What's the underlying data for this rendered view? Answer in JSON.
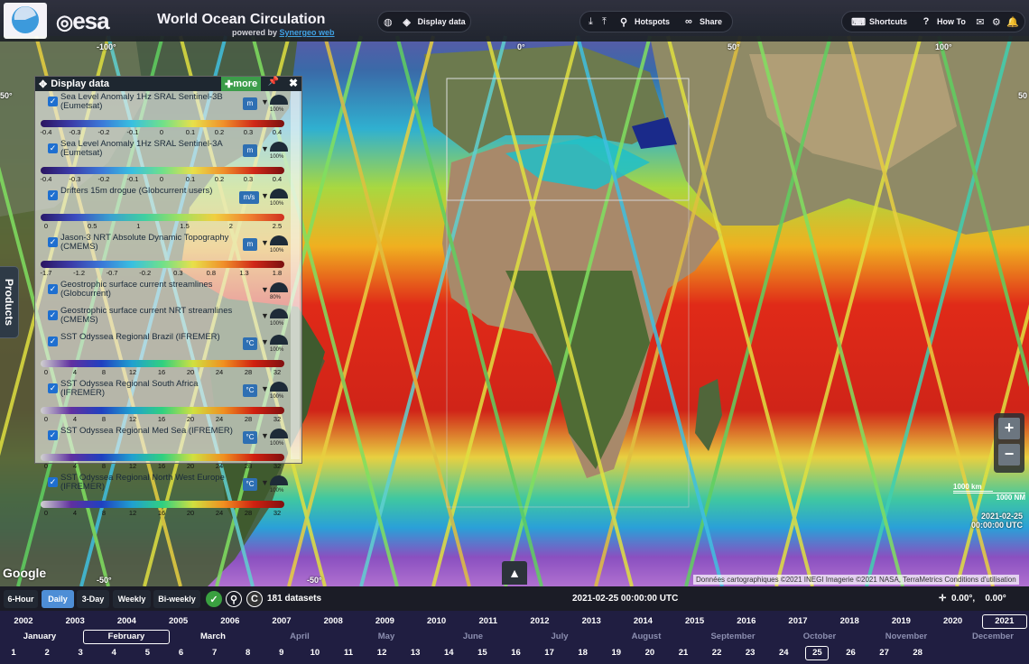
{
  "app": {
    "brand": "esa",
    "title": "World Ocean Circulation",
    "powered_prefix": "powered by",
    "powered_link": "Synergeo web"
  },
  "toolbar": {
    "display_data": "Display data",
    "hotspots": "Hotspots",
    "share": "Share",
    "shortcuts": "Shortcuts",
    "how_to": "How To"
  },
  "side_tab": "Products",
  "panel": {
    "title": "Display data",
    "more": "more",
    "layers": [
      {
        "name": "Sea Level Anomaly 1Hz SRAL Sentinel-3B (Eumetsat)",
        "unit": "m",
        "opacity": "100%",
        "scale": {
          "gradient": "linear-gradient(90deg,#2b1460,#3b3ba8,#3b78d8,#39c0e0,#6fe08a,#e8e04a,#f0902a,#d02818,#7a1010)",
          "ticks": [
            "-0.4",
            "-0.3",
            "-0.2",
            "-0.1",
            "0",
            "0.1",
            "0.2",
            "0.3",
            "0.4"
          ]
        }
      },
      {
        "name": "Sea Level Anomaly 1Hz SRAL Sentinel-3A (Eumetsat)",
        "unit": "m",
        "opacity": "100%",
        "scale": {
          "gradient": "linear-gradient(90deg,#2b1460,#3b3ba8,#3b78d8,#39c0e0,#6fe08a,#e8e04a,#f0902a,#d02818,#7a1010)",
          "ticks": [
            "-0.4",
            "-0.3",
            "-0.2",
            "-0.1",
            "0",
            "0.1",
            "0.2",
            "0.3",
            "0.4"
          ]
        }
      },
      {
        "name": "Drifters 15m drogue (Globcurrent users)",
        "unit": "m/s",
        "opacity": "100%",
        "scale": {
          "gradient": "linear-gradient(90deg,#2a1a6a,#3b4cc0,#3aa0d0,#40d0a0,#a0e060,#f0d040,#f08030,#d03020)",
          "ticks": [
            "0",
            "0.5",
            "1",
            "1.5",
            "2",
            "2.5"
          ]
        }
      },
      {
        "name": "Jason-3 NRT Absolute Dynamic Topography (CMEMS)",
        "unit": "m",
        "opacity": "100%",
        "scale": {
          "gradient": "linear-gradient(90deg,#2b1460,#3b3ba8,#3b78d8,#39c0e0,#6fe08a,#e8e04a,#f0902a,#d02818,#7a1010)",
          "ticks": [
            "-1.7",
            "-1.2",
            "-0.7",
            "-0.2",
            "0.3",
            "0.8",
            "1.3",
            "1.8"
          ]
        }
      },
      {
        "name": "Geostrophic surface current streamlines (Globcurrent)",
        "unit": "",
        "opacity": "80%",
        "scale": null
      },
      {
        "name": "Geostrophic surface current NRT streamlines (CMEMS)",
        "unit": "",
        "opacity": "100%",
        "scale": null
      },
      {
        "name": "SST Odyssea Regional Brazil (IFREMER)",
        "unit": "°C",
        "opacity": "100%",
        "scale": {
          "gradient": "linear-gradient(90deg,#d0d0d0,#6030a0,#2040c0,#20a0d0,#30d080,#d0e040,#f09020,#d02010,#801010)",
          "ticks": [
            "0",
            "4",
            "8",
            "12",
            "16",
            "20",
            "24",
            "28",
            "32"
          ]
        }
      },
      {
        "name": "SST Odyssea Regional South Africa (IFREMER)",
        "unit": "°C",
        "opacity": "100%",
        "scale": {
          "gradient": "linear-gradient(90deg,#d0d0d0,#6030a0,#2040c0,#20a0d0,#30d080,#d0e040,#f09020,#d02010,#801010)",
          "ticks": [
            "0",
            "4",
            "8",
            "12",
            "16",
            "20",
            "24",
            "28",
            "32"
          ]
        }
      },
      {
        "name": "SST Odyssea Regional Med Sea (IFREMER)",
        "unit": "°C",
        "opacity": "100%",
        "scale": {
          "gradient": "linear-gradient(90deg,#d0d0d0,#6030a0,#2040c0,#20a0d0,#30d080,#d0e040,#f09020,#d02010,#801010)",
          "ticks": [
            "0",
            "4",
            "8",
            "12",
            "16",
            "20",
            "24",
            "28",
            "32"
          ]
        }
      },
      {
        "name": "SST Odyssea Regional North West Europe (IFREMER)",
        "unit": "°C",
        "opacity": "100%",
        "scale": {
          "gradient": "linear-gradient(90deg,#d0d0d0,#6030a0,#2040c0,#20a0d0,#30d080,#d0e040,#f09020,#d02010,#801010)",
          "ticks": [
            "0",
            "4",
            "8",
            "12",
            "16",
            "20",
            "24",
            "28",
            "32"
          ]
        }
      }
    ]
  },
  "map": {
    "graticule": [
      "-100°",
      "0°",
      "50°",
      "100°",
      "50°",
      "50",
      "-50°",
      "-50°",
      "100"
    ],
    "scale_km": "1000 km",
    "scale_nm": "1000 NM",
    "overlay_date": "2021-02-25",
    "overlay_time": "00:00:00 UTC",
    "google": "Google",
    "attribution": "Données cartographiques ©2021 INEGI Imagerie ©2021 NASA, TerraMetrics   Conditions d'utilisation"
  },
  "timeline": {
    "tabs": [
      "6-Hour",
      "Daily",
      "3-Day",
      "Weekly",
      "Bi-weekly"
    ],
    "active_tab": "Daily",
    "datasets": "181 datasets",
    "current": "2021-02-25 00:00:00 UTC",
    "coord_lat": "0.00°,",
    "coord_lon": "0.00°",
    "years": [
      "2002",
      "2003",
      "2004",
      "2005",
      "2006",
      "2007",
      "2008",
      "2009",
      "2010",
      "2011",
      "2012",
      "2013",
      "2014",
      "2015",
      "2016",
      "2017",
      "2018",
      "2019",
      "2020",
      "2021"
    ],
    "selected_year": "2021",
    "months": [
      "January",
      "February",
      "March",
      "April",
      "May",
      "June",
      "July",
      "August",
      "September",
      "October",
      "November",
      "December"
    ],
    "selected_month": "February",
    "days": [
      "1",
      "2",
      "3",
      "4",
      "5",
      "6",
      "7",
      "8",
      "9",
      "10",
      "11",
      "12",
      "13",
      "14",
      "15",
      "16",
      "17",
      "18",
      "19",
      "20",
      "21",
      "22",
      "23",
      "24",
      "25",
      "26",
      "27",
      "28"
    ],
    "selected_day": "25"
  }
}
